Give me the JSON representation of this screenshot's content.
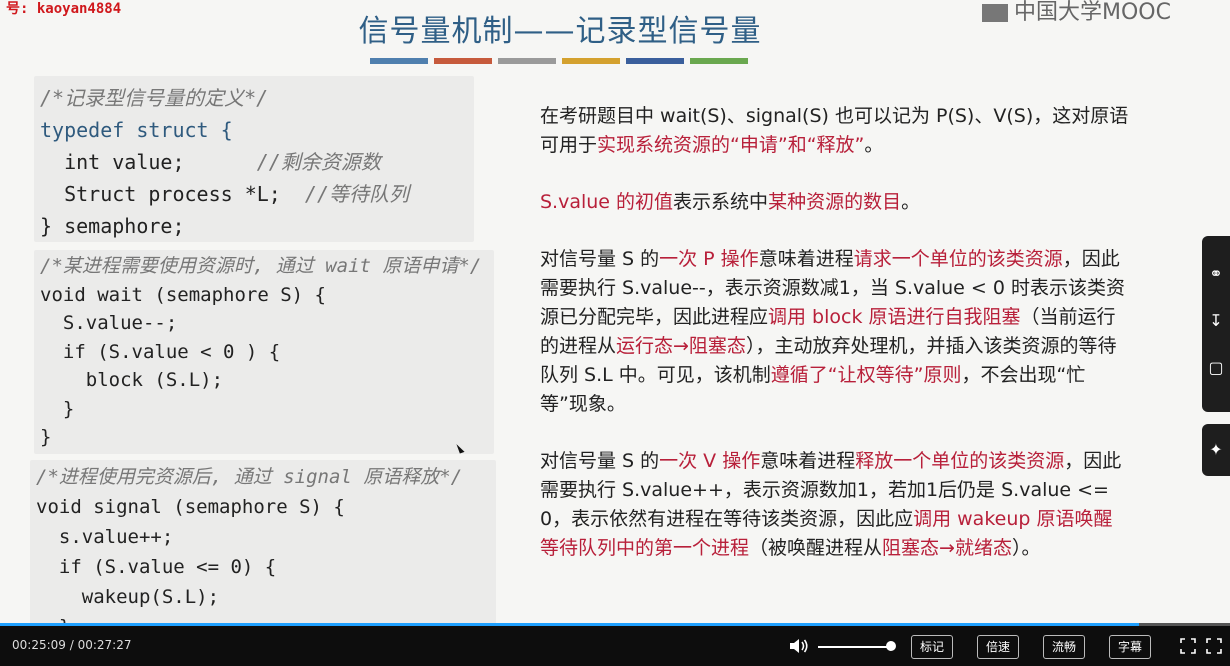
{
  "watermark": "号: kaoyan4884",
  "logo": "中国大学MOOC",
  "title": "信号量机制——记录型信号量",
  "strip_colors": [
    "#4f7fae",
    "#c65a3c",
    "#9a9a9a",
    "#d4a12e",
    "#3a5f9c",
    "#6aa84f"
  ],
  "code1": {
    "comment": "/*记录型信号量的定义*/",
    "l1": "typedef struct {",
    "l2": "  int value;",
    "l2c": "//剩余资源数",
    "l3": "  Struct process *L;",
    "l3c": "//等待队列",
    "l4": "} semaphore;"
  },
  "code2": {
    "comment": "/*某进程需要使用资源时, 通过 wait 原语申请*/",
    "l1": "void wait (semaphore S) {",
    "l2": "  S.value--;",
    "l3": "  if (S.value < 0 ) {",
    "l4": "    block (S.L);",
    "l5": "  }",
    "l6": "}"
  },
  "code3": {
    "comment": "/*进程使用完资源后, 通过 signal 原语释放*/",
    "l1": "void signal (semaphore S) {",
    "l2": "  s.value++;",
    "l3": "  if (S.value <= 0) {",
    "l4": "    wakeup(S.L);",
    "l5": "  }"
  },
  "para1": {
    "a": "在考研题目中 wait(S)、signal(S) 也可以记为 P(S)、V(S)，这对原语可用于",
    "b": "实现系统资源的“申请”和“释放”",
    "c": "。"
  },
  "para2": {
    "a": "S.value 的初值",
    "b": "表示系统中",
    "c": "某种资源的数目",
    "d": "。"
  },
  "para3": {
    "a": "对信号量 S 的",
    "b": "一次 P 操作",
    "c": "意味着进程",
    "d": "请求一个单位的该类资源",
    "e": "，因此需要执行 S.value--，表示资源数减1，当 S.value < 0 时表示该类资源已分配完毕，因此进程应",
    "f": "调用 block 原语进行自我阻塞",
    "g": "（当前运行的进程从",
    "h": "运行态→阻塞态",
    "i": "），主动放弃处理机，并插入该类资源的等待队列 S.L 中。可见，该机制",
    "j": "遵循了“让权等待”原则",
    "k": "，不会出现“忙等”现象。"
  },
  "para4": {
    "a": "对信号量 S 的",
    "b": "一次 V 操作",
    "c": "意味着进程",
    "d": "释放一个单位的该类资源",
    "e": "，因此需要执行 S.value++，表示资源数加1，若加1后仍是 S.value <= 0，表示依然有进程在等待该类资源，因此应",
    "f": "调用 wakeup 原语唤醒等待队列中的第一个进程",
    "g": "（被唤醒进程从",
    "h": "阻塞态→就绪态",
    "i": "）。"
  },
  "player": {
    "time": "00:25:09 / 00:27:27",
    "progress": 0.926,
    "volume": 0.9,
    "btn_mark": "标记",
    "btn_speed": "倍速",
    "btn_quality": "流畅",
    "btn_subtitle": "字幕"
  },
  "icons": {
    "volume": "volume-icon",
    "fullscreen": "fullscreen-icon",
    "settings": "settings-icon"
  }
}
